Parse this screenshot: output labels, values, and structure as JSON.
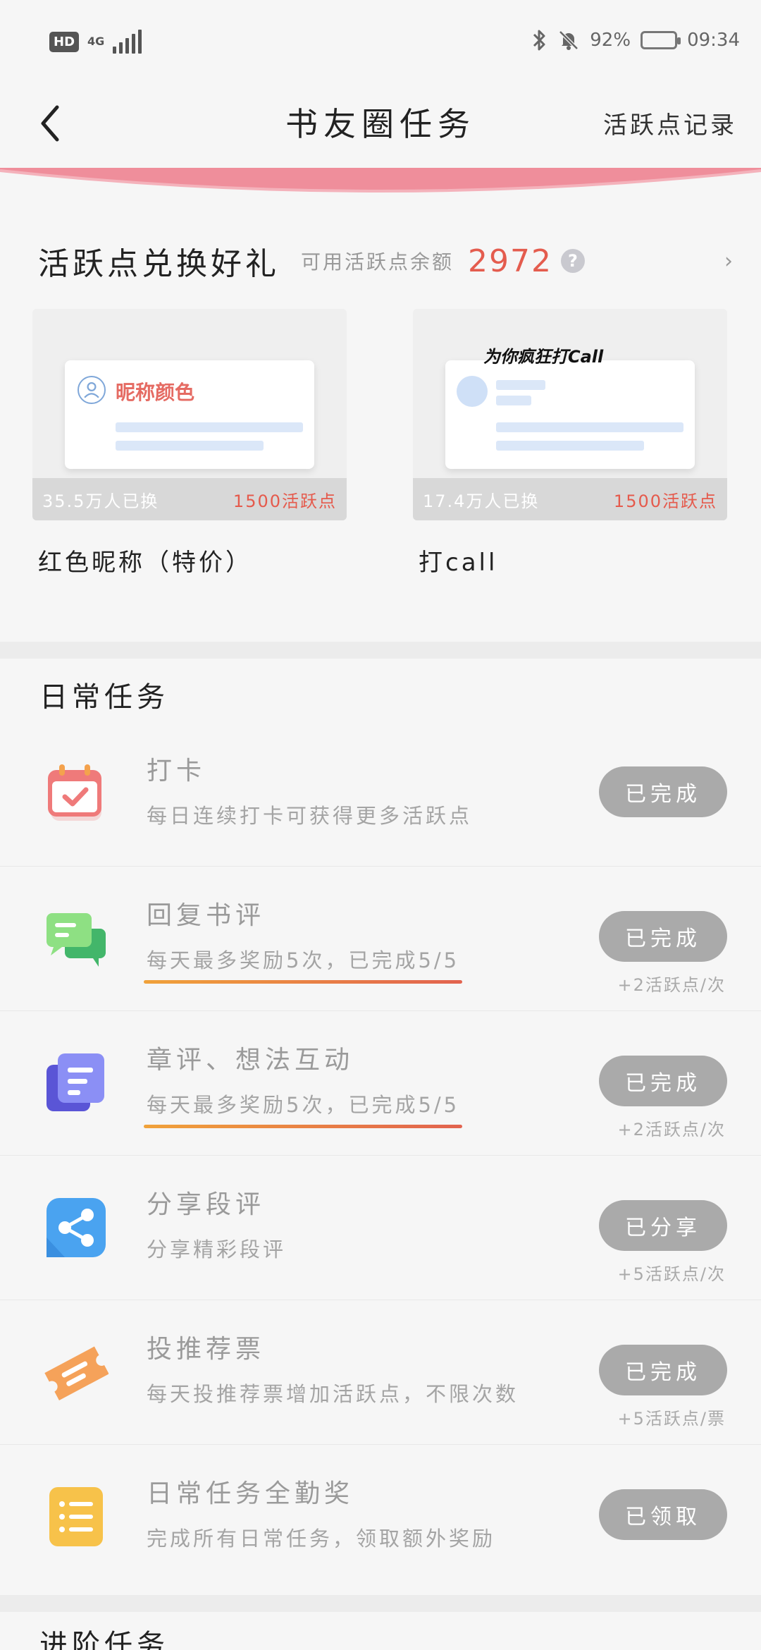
{
  "status_bar": {
    "hd": "HD",
    "network": "4G",
    "battery": "92%",
    "battery_level": 0.92,
    "time": "09:34"
  },
  "header": {
    "back_icon": "chevron-left-icon",
    "title": "书友圈任务",
    "records_link": "活跃点记录"
  },
  "exchange": {
    "title": "活跃点兑换好礼",
    "balance_label": "可用活跃点余额",
    "balance": "2972",
    "help_icon": "?",
    "more_icon": "›",
    "rewards": [
      {
        "name": "红色昵称（特价）",
        "preview_text": "昵称颜色",
        "count": "35.5万人已换",
        "cost": "1500活跃点"
      },
      {
        "name": "打call",
        "preview_text": "为你疯狂打Call",
        "count": "17.4万人已换",
        "cost": "1500活跃点"
      }
    ]
  },
  "daily": {
    "title": "日常任务",
    "tasks": [
      {
        "name": "打卡",
        "desc": "每日连续打卡可获得更多活跃点",
        "button": "已完成",
        "reward": "",
        "icon": "calendar-check-icon",
        "color": "#ef7a7a",
        "progress": null
      },
      {
        "name": "回复书评",
        "desc": "每天最多奖励5次，已完成5/5",
        "button": "已完成",
        "reward": "+2活跃点/次",
        "icon": "chat-bubbles-icon",
        "color": "#6ccf6e",
        "progress": 1.0
      },
      {
        "name": "章评、想法互动",
        "desc": "每天最多奖励5次，已完成5/5",
        "button": "已完成",
        "reward": "+2活跃点/次",
        "icon": "document-icon",
        "color": "#6f73ee",
        "progress": 1.0
      },
      {
        "name": "分享段评",
        "desc": "分享精彩段评",
        "button": "已分享",
        "reward": "+5活跃点/次",
        "icon": "share-icon",
        "color": "#4aa3f0",
        "progress": null
      },
      {
        "name": "投推荐票",
        "desc": "每天投推荐票增加活跃点，不限次数",
        "button": "已完成",
        "reward": "+5活跃点/票",
        "icon": "ticket-icon",
        "color": "#f5a25a",
        "progress": null
      },
      {
        "name": "日常任务全勤奖",
        "desc": "完成所有日常任务，领取额外奖励",
        "button": "已领取",
        "reward": "",
        "icon": "list-icon",
        "color": "#f7c24a",
        "progress": null
      }
    ]
  },
  "advanced": {
    "title": "进阶任务"
  }
}
